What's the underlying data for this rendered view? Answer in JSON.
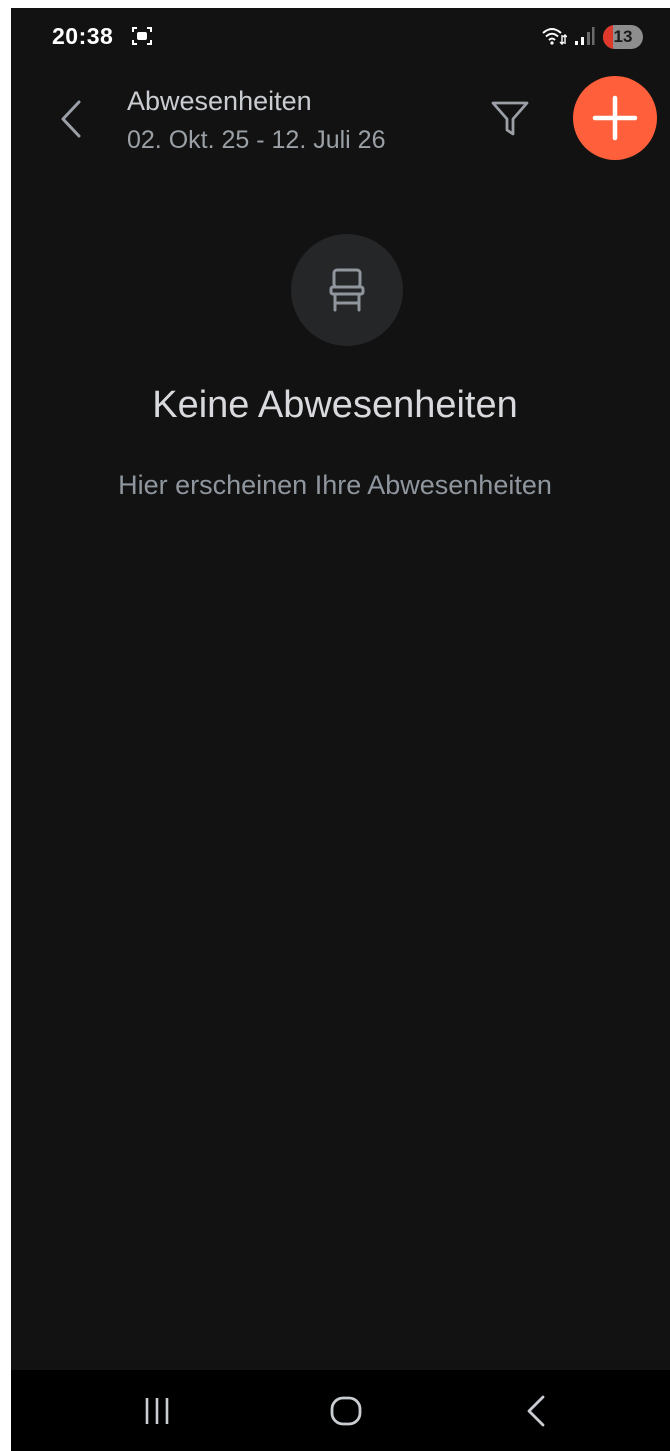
{
  "status_bar": {
    "time": "20:38",
    "battery_level": "13",
    "icons": [
      "screenshot-icon",
      "wifi-icon",
      "signal-icon",
      "battery-icon"
    ]
  },
  "header": {
    "title": "Abwesenheiten",
    "subtitle": "02. Okt. 25 - 12. Juli 26",
    "icons": [
      "back-chevron-icon",
      "filter-icon",
      "plus-icon"
    ]
  },
  "empty_state": {
    "icon": "chair-icon",
    "title": "Keine Abwesenheiten",
    "subtitle": "Hier erscheinen Ihre Abwesenheiten"
  },
  "nav_bar": {
    "icons": [
      "recent-apps-icon",
      "home-icon",
      "back-icon"
    ]
  },
  "colors": {
    "background": "#121212",
    "accent": "#ff5f3a",
    "title_text": "#c9ccd1",
    "secondary_text": "#9aa0a6",
    "battery_low": "#e0392b"
  }
}
